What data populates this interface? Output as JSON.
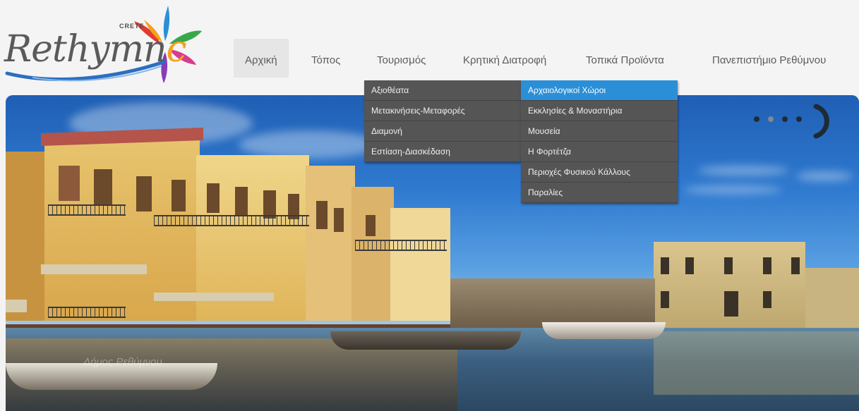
{
  "logo": {
    "text": "Rethymn",
    "subtext": "CRETE",
    "accent_c": "c",
    "colors": [
      "#e23b2e",
      "#f4a11e",
      "#2b8fd8",
      "#36a84a",
      "#8a3bb8",
      "#d83c8c"
    ]
  },
  "nav": {
    "items": [
      {
        "label": "Αρχική",
        "active": true
      },
      {
        "label": "Τόπος"
      },
      {
        "label": "Τουρισμός"
      },
      {
        "label": "Κρητική Διατροφή"
      },
      {
        "label": "Τοπικά Προϊόντα"
      },
      {
        "label": "Πανεπιστήμιο Ρεθύμνου"
      }
    ]
  },
  "dropdown_tourism": {
    "items": [
      {
        "label": "Αξιοθέατα"
      },
      {
        "label": "Μετακινήσεις-Μεταφορές"
      },
      {
        "label": "Διαμονή"
      },
      {
        "label": "Εστίαση-Διασκέδαση"
      }
    ]
  },
  "dropdown_sights": {
    "items": [
      {
        "label": "Αρχαιολογικοί Χώροι",
        "active": true
      },
      {
        "label": "Εκκλησίες & Μοναστήρια"
      },
      {
        "label": "Μουσεία"
      },
      {
        "label": "Η Φορτέτζα"
      },
      {
        "label": "Περιοχές Φυσικού Κάλλους"
      },
      {
        "label": "Παραλίες"
      }
    ]
  },
  "slider": {
    "dot_count": 4,
    "active_dot": 2,
    "watermark": "Δήμος Ρεθύμνου"
  },
  "colors": {
    "header_bg": "#f4f4f4",
    "menu_bg": "#555555",
    "menu_active": "#2b8fd8",
    "nav_text": "#5c5c5c"
  }
}
